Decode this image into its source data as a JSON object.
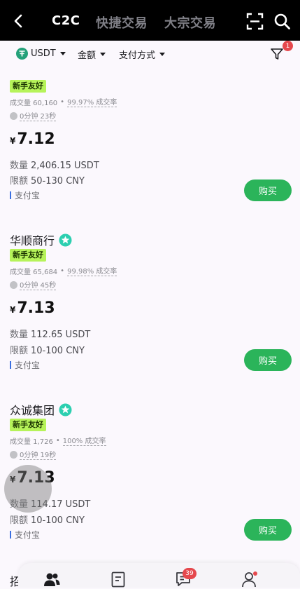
{
  "header": {
    "tabs": [
      {
        "label": "C2C",
        "active": true
      },
      {
        "label": "快捷交易",
        "active": false
      },
      {
        "label": "大宗交易",
        "active": false
      }
    ]
  },
  "filters": {
    "currency": "USDT",
    "amount": "金额",
    "payment": "支付方式",
    "filter_badge": "1"
  },
  "offers": [
    {
      "name": "",
      "tag": "新手友好",
      "volume_label": "成交量 60,160",
      "rate": "99.97% 成交率",
      "time": "0分钟 23秒",
      "currency_symbol": "¥",
      "price": "7.12",
      "qty_label": "数量",
      "qty": "2,406.15 USDT",
      "limit_label": "限额",
      "limit": "50-130 CNY",
      "payment": "支付宝",
      "button": "购买"
    },
    {
      "name": "华顺商行",
      "tag": "新手友好",
      "volume_label": "成交量 65,684",
      "rate": "99.98% 成交率",
      "time": "0分钟 45秒",
      "currency_symbol": "¥",
      "price": "7.13",
      "qty_label": "数量",
      "qty": "112.65 USDT",
      "limit_label": "限额",
      "limit": "10-100 CNY",
      "payment": "支付宝",
      "button": "购买"
    },
    {
      "name": "众诚集团",
      "tag": "新手友好",
      "volume_label": "成交量 1,726",
      "rate": "100% 成交率",
      "time": "0分钟 19秒",
      "currency_symbol": "¥",
      "price": "7.13",
      "qty_label": "数量",
      "qty": "114.17 USDT",
      "limit_label": "限额",
      "limit": "10-100 CNY",
      "payment": "支付宝",
      "button": "购买"
    }
  ],
  "partial_next": "招",
  "bottom_nav": {
    "messages_badge": "39"
  },
  "colors": {
    "accent_green": "#2bb45a",
    "tag_green": "#b6f35a",
    "badge_red": "#e5484d"
  }
}
